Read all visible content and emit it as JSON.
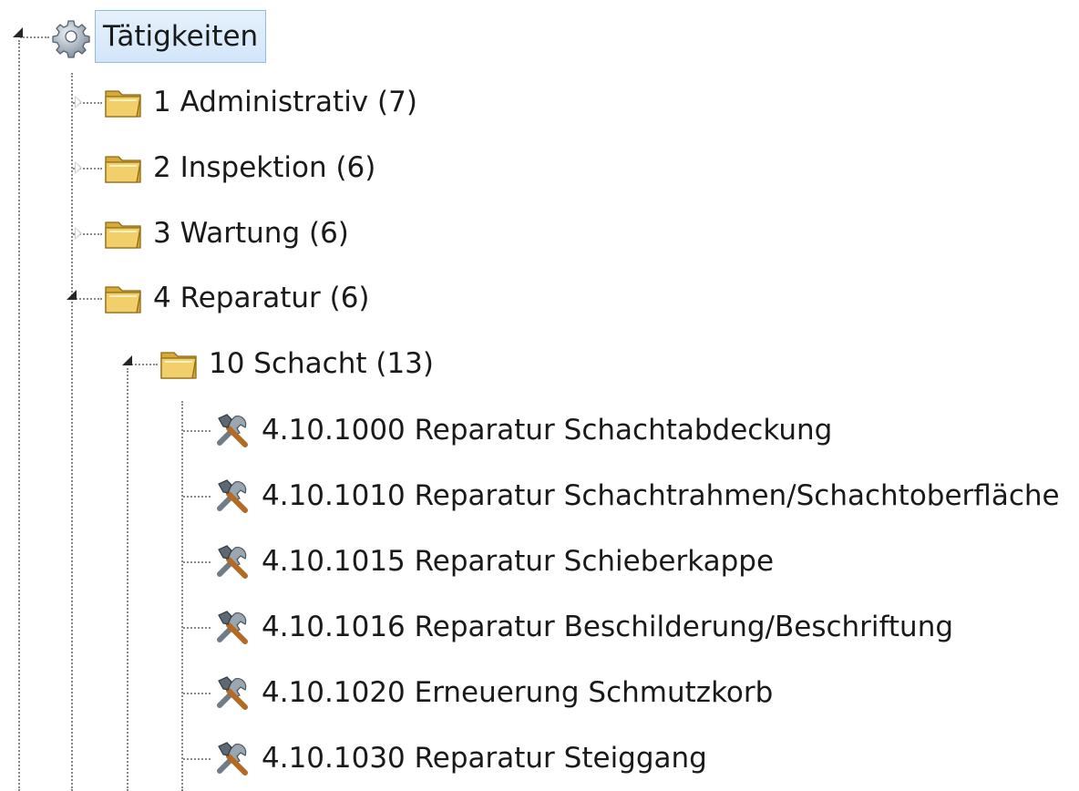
{
  "tree": {
    "root": {
      "label": "Tätigkeiten",
      "icon": "gear-icon",
      "expanded": true,
      "selected": true
    },
    "categories": [
      {
        "label": "1 Administrativ (7)",
        "icon": "folder-icon",
        "expanded": false
      },
      {
        "label": "2 Inspektion (6)",
        "icon": "folder-icon",
        "expanded": false
      },
      {
        "label": "3 Wartung (6)",
        "icon": "folder-icon",
        "expanded": false
      },
      {
        "label": "4 Reparatur (6)",
        "icon": "folder-icon",
        "expanded": true,
        "children": [
          {
            "label": "10 Schacht (13)",
            "icon": "folder-icon",
            "expanded": true,
            "children": [
              {
                "label": "4.10.1000 Reparatur Schachtabdeckung",
                "icon": "tools-icon"
              },
              {
                "label": "4.10.1010 Reparatur Schachtrahmen/Schachtoberfläche",
                "icon": "tools-icon"
              },
              {
                "label": "4.10.1015 Reparatur Schieberkappe",
                "icon": "tools-icon"
              },
              {
                "label": "4.10.1016 Reparatur Beschilderung/Beschriftung",
                "icon": "tools-icon"
              },
              {
                "label": "4.10.1020 Erneuerung Schmutzkorb",
                "icon": "tools-icon"
              },
              {
                "label": "4.10.1030 Reparatur Steiggang",
                "icon": "tools-icon"
              }
            ]
          }
        ]
      }
    ]
  },
  "colors": {
    "selection_background": "#d9eafb",
    "selection_border": "#8fbbe8",
    "folder": "#e8bf55",
    "tree_lines": "#8a8a8a"
  }
}
